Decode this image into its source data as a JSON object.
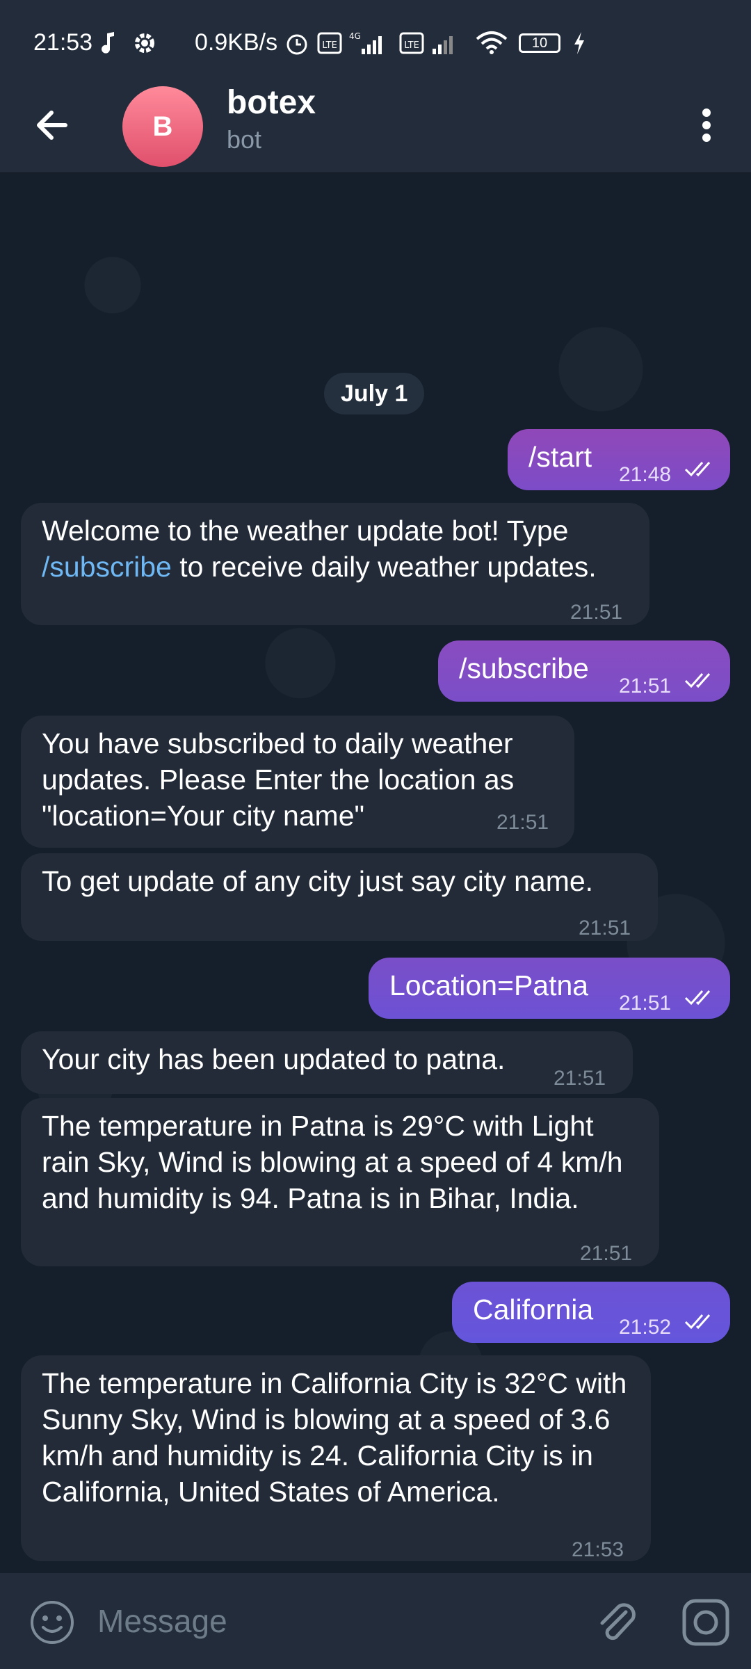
{
  "status_bar": {
    "time": "21:53",
    "net_speed": "0.9KB/s",
    "battery": "10"
  },
  "header": {
    "avatar_letter": "B",
    "title": "botex",
    "subtitle": "bot"
  },
  "chat": {
    "date": "July 1",
    "messages": [
      {
        "dir": "out",
        "text": "/start",
        "time": "21:48"
      },
      {
        "dir": "in",
        "text_pre": "Welcome to the weather update bot! Type ",
        "link": "/subscribe",
        "text_post": " to receive daily weather updates.",
        "time": "21:51"
      },
      {
        "dir": "out",
        "text": "/subscribe",
        "time": "21:51"
      },
      {
        "dir": "in",
        "text": "You have subscribed to daily weather updates. Please Enter the location as \"location=Your city name\"",
        "time": "21:51"
      },
      {
        "dir": "in",
        "text": "To get update of any city just say city name.",
        "time": "21:51"
      },
      {
        "dir": "out",
        "text": "Location=Patna",
        "time": "21:51"
      },
      {
        "dir": "in",
        "text": "Your city has been updated to patna.",
        "time": "21:51"
      },
      {
        "dir": "in",
        "text": "The temperature in Patna is 29°C with Light rain Sky, Wind is blowing at a speed of 4 km/h and humidity is 94. Patna is in Bihar, India.",
        "time": "21:51"
      },
      {
        "dir": "out",
        "text": "California",
        "time": "21:52"
      },
      {
        "dir": "in",
        "text": "The temperature in California City is 32°C with Sunny Sky, Wind is blowing at a speed of 3.6 km/h and humidity is 24. California City is in California, United States of America.",
        "time": "21:53"
      }
    ]
  },
  "input": {
    "placeholder": "Message"
  },
  "colors": {
    "out_bubble_top": "#8e4cc0",
    "out_bubble_bottom": "#6a55d8",
    "in_bubble": "#222b37",
    "link": "#6fb8f4"
  },
  "icons": [
    "music-note-icon",
    "gear-icon",
    "alarm-icon",
    "volte-icon",
    "signal-icon",
    "wifi-icon",
    "battery-icon",
    "charging-icon",
    "back-arrow-icon",
    "more-vertical-icon",
    "double-check-icon",
    "emoji-icon",
    "paperclip-icon",
    "camera-icon"
  ]
}
